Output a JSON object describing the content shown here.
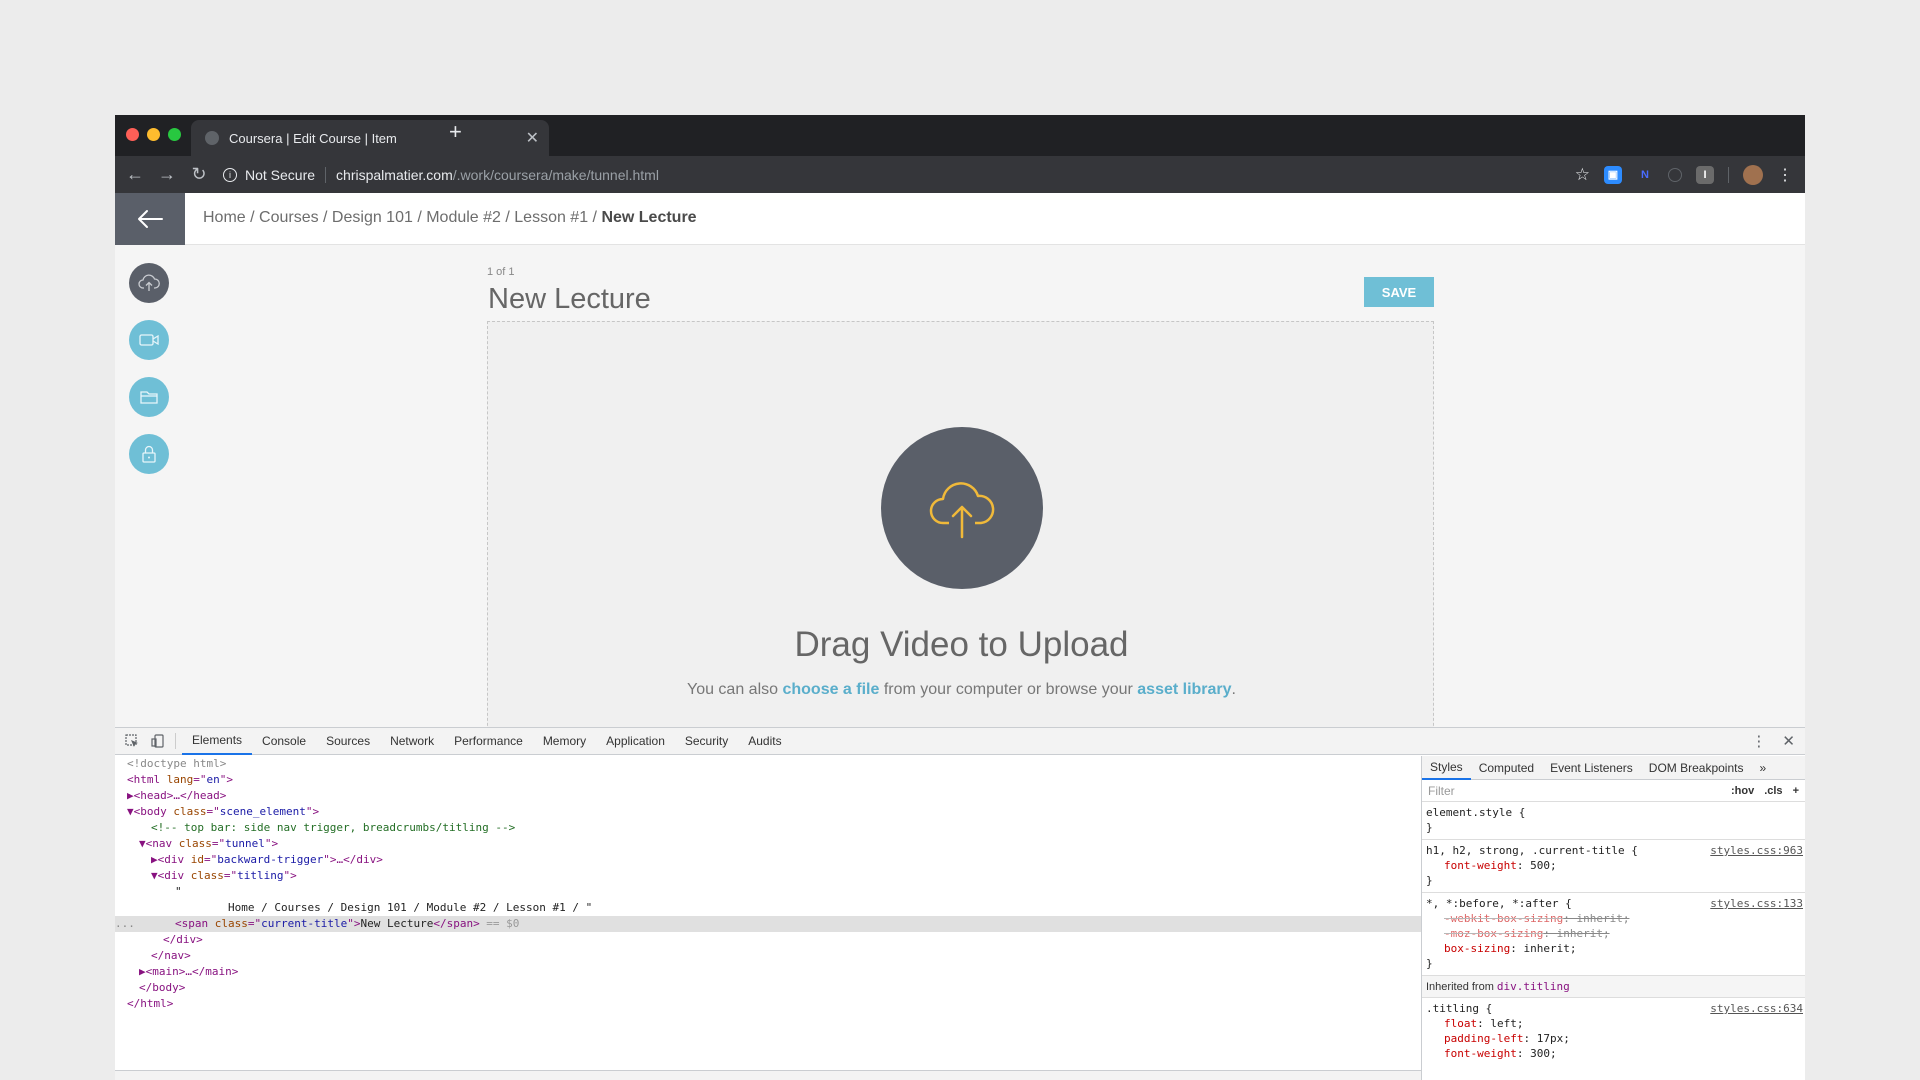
{
  "browser": {
    "tab_title": "Coursera | Edit Course | Item",
    "tab_close": "✕",
    "new_tab": "+",
    "back": "←",
    "forward": "→",
    "reload": "↻",
    "info": "i",
    "not_secure": "Not Secure",
    "url_host": "chrispalmatier.com",
    "url_path": "/.work/coursera/make/tunnel.html",
    "star": "☆",
    "menu": "⋮",
    "ext_zoom": "▣",
    "ext_n": "N",
    "ext_i": "I",
    "lights": {
      "red": "#fe5f57",
      "yellow": "#febc2e",
      "green": "#28c840"
    }
  },
  "page": {
    "breadcrumbs": "Home / Courses / Design 101 / Module #2 / Lesson #1 / ",
    "current_title": "New Lecture",
    "counter": "1 of 1",
    "title": "New Lecture",
    "save_label": "SAVE",
    "drag_title": "Drag Video to Upload",
    "drag_sub_1": "You can also ",
    "drag_link_1": "choose a file",
    "drag_sub_2": " from your computer or browse your ",
    "drag_link_2": "asset library",
    "drag_sub_3": ".",
    "accent": "#6fbfd6",
    "dark": "#5a5f69",
    "upload_color": "#f0b93a"
  },
  "devtools": {
    "tabs": [
      "Elements",
      "Console",
      "Sources",
      "Network",
      "Performance",
      "Memory",
      "Application",
      "Security",
      "Audits"
    ],
    "close": "✕",
    "menu": "⋮",
    "lines": {
      "l1": "<!doctype html>",
      "l2a": "<html ",
      "l2b": "lang",
      "l2c": "=\"",
      "l2d": "en",
      "l2e": "\">",
      "l3": "▶<head>…</head>",
      "l4a": "▼<body ",
      "l4b": "class",
      "l4c": "=\"",
      "l4d": "scene_element",
      "l4e": "\">",
      "l5": "<!-- top bar: side nav trigger, breadcrumbs/titling -->",
      "l6a": "▼<nav ",
      "l6b": "class",
      "l6c": "=\"",
      "l6d": "tunnel",
      "l6e": "\">",
      "l7a": "▶<div ",
      "l7b": "id",
      "l7c": "=\"",
      "l7d": "backward-trigger",
      "l7e": "\">…</div>",
      "l8a": "▼<div ",
      "l8b": "class",
      "l8c": "=\"",
      "l8d": "titling",
      "l8e": "\">",
      "l9": "\"",
      "l10": "Home / Courses / Design 101 / Module #2 / Lesson #1 / \"",
      "l11pre": "...",
      "l11a": "<span ",
      "l11b": "class",
      "l11c": "=\"",
      "l11d": "current-title",
      "l11e": "\">",
      "l11f": "New Lecture",
      "l11g": "</span>",
      "l11h": " == $0",
      "l12": "</div>",
      "l13": "</nav>",
      "l14": "▶<main>…</main>",
      "l15": "</body>",
      "l16": "</html>"
    },
    "styles": {
      "tabs": [
        "Styles",
        "Computed",
        "Event Listeners",
        "DOM Breakpoints",
        "»"
      ],
      "filter": "Filter",
      "hov": ":hov",
      "cls": ".cls",
      "plus": "+",
      "r1_sel": "element.style {",
      "r1_end": "}",
      "r2_sel": "h1, h2, strong, .current-title {",
      "r2_src": "styles.css:963",
      "r2_p1n": "font-weight",
      "r2_p1v": ": 500;",
      "r2_end": "}",
      "r3_sel": "*, *:before, *:after {",
      "r3_src": "styles.css:133",
      "r3_p1n": "-webkit-box-sizing",
      "r3_p1v": ": inherit;",
      "r3_p2n": "-moz-box-sizing",
      "r3_p2v": ": inherit;",
      "r3_p3n": "box-sizing",
      "r3_p3v": ": inherit;",
      "r3_end": "}",
      "inherit_label": "Inherited from ",
      "inherit_sel": "div.titling",
      "r4_sel": ".titling {",
      "r4_src": "styles.css:634",
      "r4_p1n": "float",
      "r4_p1v": ": left;",
      "r4_p2n": "padding-left",
      "r4_p2v": ": 17px;",
      "r4_p3n": "font-weight",
      "r4_p3v": ": 300;"
    }
  }
}
